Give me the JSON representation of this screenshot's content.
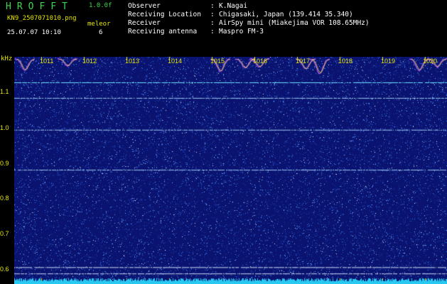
{
  "header": {
    "app_name": "HROFFT",
    "version": "1.0.0f",
    "filename": "KN9_2507071010.png",
    "mode_label": "meleor",
    "mode_value": "6",
    "datetime": "25.07.07 10:10"
  },
  "info": [
    {
      "label": "Observer",
      "value": "K.Nagai"
    },
    {
      "label": "Receiving Location",
      "value": "Chigasaki, Japan (139.414 35.340)"
    },
    {
      "label": "Receiver",
      "value": "AirSpy mini (Miakejima VOR 108.65MHz)"
    },
    {
      "label": "Receiving antenna",
      "value": "Maspro FM-3"
    }
  ],
  "separator": ":",
  "spectrogram": {
    "unit": "kHz",
    "y_ticks": [
      "1.1",
      "1.0",
      "0.9",
      "0.8",
      "0.7",
      "0.6"
    ],
    "x_ticks": [
      "1011",
      "1012",
      "1013",
      "1014",
      "1015",
      "1016",
      "1017",
      "1018",
      "1019",
      "1020"
    ],
    "y_range": [
      0.58,
      1.18
    ],
    "signal_lines_khz": [
      1.111,
      1.069,
      0.983,
      0.875,
      0.612,
      0.595
    ],
    "colors": {
      "background": "#0a1470",
      "noise": "#3a78e8",
      "signal_line": "#70e0ff",
      "trace": "#c060ff",
      "bottom_band": "#28c8f0",
      "tick_text": "#e6e600"
    }
  }
}
